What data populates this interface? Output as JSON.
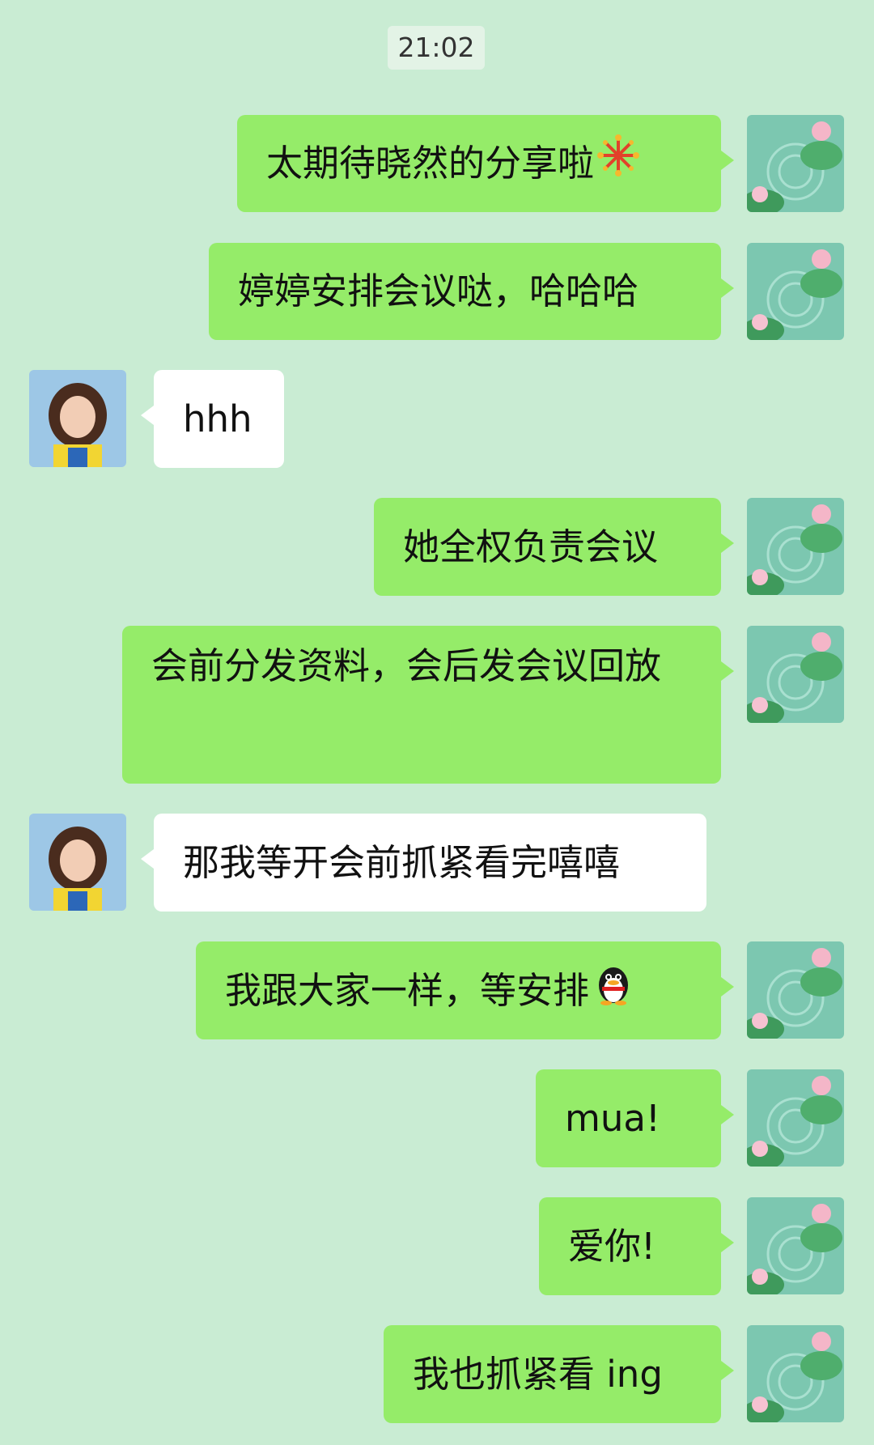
{
  "time": "21:02",
  "messages": [
    {
      "side": "out",
      "text": "太期待晓然的分享啦",
      "emoji": "fireworks-icon"
    },
    {
      "side": "out",
      "text": "婷婷安排会议哒，哈哈哈"
    },
    {
      "side": "in",
      "text": "hhh"
    },
    {
      "side": "out",
      "text": "她全权负责会议"
    },
    {
      "side": "out",
      "text": "会前分发资料，会后发会议回放"
    },
    {
      "side": "in",
      "text": "那我等开会前抓紧看完嘻嘻"
    },
    {
      "side": "out",
      "text": "我跟大家一样，等安排",
      "emoji": "penguin-icon"
    },
    {
      "side": "out",
      "text": "mua!"
    },
    {
      "side": "out",
      "text": "爱你!"
    },
    {
      "side": "out",
      "text": "我也抓紧看 ing"
    }
  ],
  "colors": {
    "background": "#c9ecd3",
    "outgoing_bubble": "#95ec69",
    "incoming_bubble": "#ffffff"
  }
}
